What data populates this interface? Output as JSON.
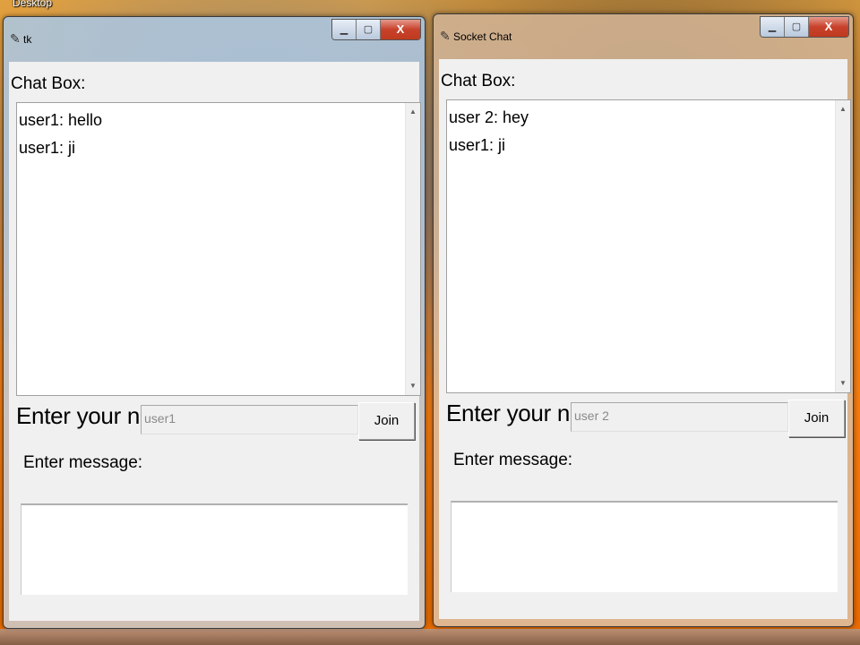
{
  "desktop": {
    "label": "Desktop"
  },
  "windows": [
    {
      "title": "tk",
      "title_icon": "feather-icon",
      "caption": {
        "minimize": "▁",
        "maximize": "▢",
        "close": "X"
      },
      "chat_label": "Chat Box:",
      "messages": [
        "user1: hello",
        "user1: ji"
      ],
      "name_label": "Enter your name:",
      "name_value": "user1",
      "join_label": "Join",
      "message_label": "Enter message:",
      "message_value": ""
    },
    {
      "title": "Socket Chat",
      "title_icon": "feather-icon",
      "caption": {
        "minimize": "▁",
        "maximize": "▢",
        "close": "X"
      },
      "chat_label": "Chat Box:",
      "messages": [
        "user 2: hey",
        "user1: ji"
      ],
      "name_label": "Enter your name:",
      "name_value": "user 2",
      "join_label": "Join",
      "message_label": "Enter message:",
      "message_value": ""
    }
  ],
  "colors": {
    "client_bg": "#f0f0f0",
    "close_button": "#c8412c",
    "disabled_text": "#8a8a8a"
  }
}
